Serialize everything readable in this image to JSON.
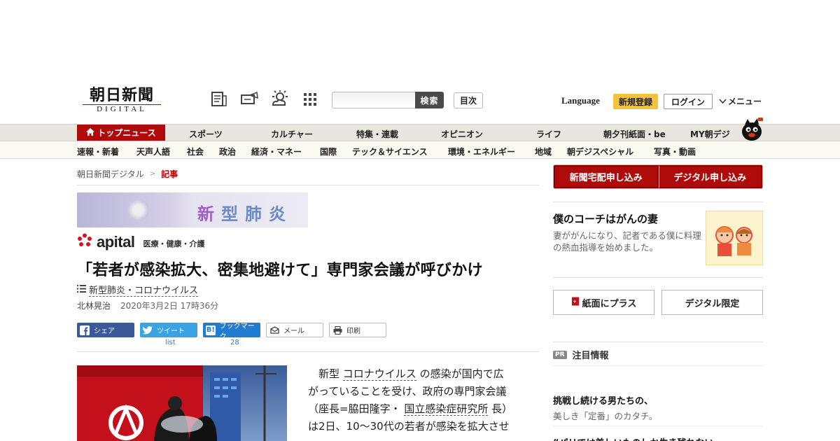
{
  "header": {
    "logo_main": "朝日新聞",
    "logo_sub": "DIGITAL",
    "icons": [
      "newspaper-icon",
      "ticket-icon",
      "weather-icon",
      "apps-grid-icon"
    ],
    "search_button": "検索",
    "toc_button": "目次",
    "language": "Language",
    "register": "新規登録",
    "login": "ログイン",
    "menu": "メニュー"
  },
  "nav_main": {
    "top_news": "トップニュース",
    "items": [
      "スポーツ",
      "カルチャー",
      "特集・連載",
      "オピニオン",
      "ライフ",
      "朝夕刊紙面・be",
      "MY朝デジ"
    ]
  },
  "nav_sub": {
    "items": [
      "速報・新着",
      "天声人語",
      "社会",
      "政治",
      "経済・マネー",
      "国際",
      "テック＆サイエンス",
      "環境・エネルギー",
      "地域",
      "朝デジスペシャル",
      "写真・動画"
    ]
  },
  "breadcrumb": {
    "home": "朝日新聞デジタル",
    "current": "記事"
  },
  "banner": {
    "text": "新型肺炎"
  },
  "apital": {
    "word": "apital",
    "sub": "医療・健康・介護"
  },
  "article": {
    "headline": "「若者が感染拡大、密集地避けて」専門家会議が呼びかけ",
    "tag": "新型肺炎・コロナウイルス",
    "author": "北林晃治",
    "date": "2020年3月2日 17時36分",
    "body_lines": [
      [
        "　新型 ",
        "コロナウイルス",
        " の感染が国内で広"
      ],
      [
        "がっていることを受け、政府の専門家会議"
      ],
      [
        "（座長=脇田隆字・ ",
        "国立感染症研究所",
        " 長）"
      ],
      [
        "は2日、10～30代の若者が感染を拡大させ"
      ]
    ]
  },
  "share": {
    "facebook": "シェア",
    "twitter": "ツイート",
    "twitter_count": "list",
    "hatena": "ブックマーク",
    "hatena_count": "28",
    "mail": "メール",
    "print": "印刷"
  },
  "sidebar": {
    "subscribe_paper": "新聞宅配申し込み",
    "subscribe_digital": "デジタル申し込み",
    "coach_title": "僕のコーチはがんの妻",
    "coach_desc": "妻ががんになり、記者である僕に料理の熱血指導を始めました。",
    "plus_paper": "紙面にプラス",
    "digital_only": "デジタル限定",
    "pr_badge": "PR",
    "pr_heading": "注目情報",
    "pr_item_title": "挑戦し続ける男たちの、",
    "pr_item_desc": "美しき「定番」のカタチ。",
    "pr_item2_title": "“パリでは美しいものしか生き残れない"
  },
  "colors": {
    "brand_red": "#b00b0b",
    "register_yellow": "#f5c33b",
    "facebook": "#3b5998",
    "twitter": "#3aa3e3",
    "hatena": "#1f7cd0"
  }
}
